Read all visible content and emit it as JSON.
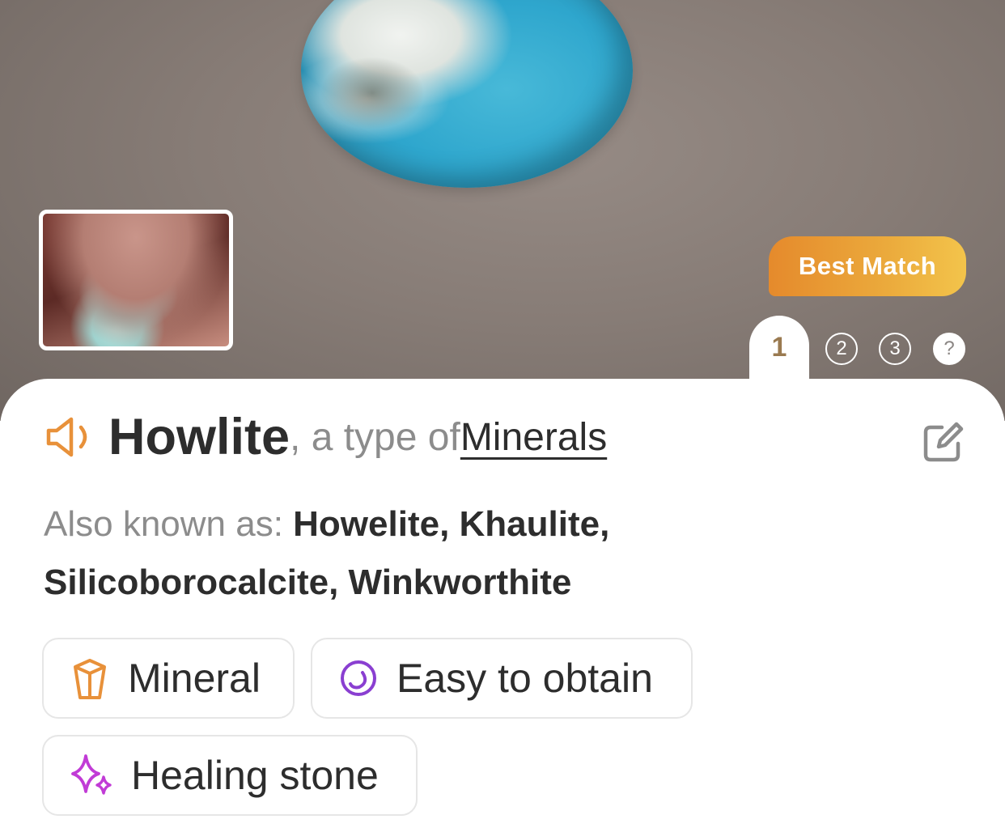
{
  "hero": {
    "badge_label": "Best Match",
    "pages": [
      "1",
      "2",
      "3",
      "?"
    ]
  },
  "result": {
    "name": "Howlite",
    "type_separator": ", a type of ",
    "type_link": "Minerals",
    "aka_label": "Also known as: ",
    "aka_names": "Howelite, Khaulite, Silicoborocalcite, Winkworthite"
  },
  "chips": [
    {
      "label": "Mineral",
      "icon": "crystal-icon",
      "color": "#e8913a"
    },
    {
      "label": "Easy to obtain",
      "icon": "circle-swirl-icon",
      "color": "#8a3fd1"
    },
    {
      "label": "Healing stone",
      "icon": "sparkle-icon",
      "color": "#c13bd6"
    }
  ],
  "colors": {
    "accent_orange": "#e8913a",
    "badge_gradient_start": "#e58a2c",
    "badge_gradient_end": "#f3c44b",
    "active_page_text": "#9a7a50"
  }
}
